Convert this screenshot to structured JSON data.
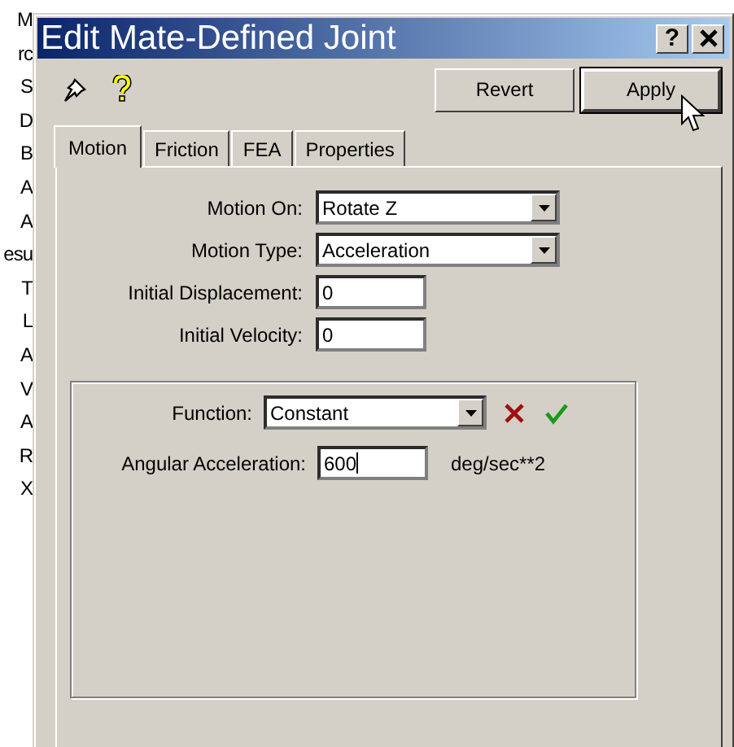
{
  "background_list": {
    "items": [
      "M",
      "rc",
      "S",
      "D",
      "B",
      "A",
      "A",
      "esu",
      "T",
      "L",
      "A",
      "V",
      "A",
      "R",
      "X"
    ]
  },
  "window": {
    "title": "Edit Mate-Defined Joint",
    "help_button": "?"
  },
  "toolbar": {
    "buttons": [
      {
        "label": "Revert",
        "focused": false
      },
      {
        "label": "Apply",
        "focused": true
      }
    ]
  },
  "tabs": [
    {
      "label": "Motion",
      "selected": true
    },
    {
      "label": "Friction",
      "selected": false
    },
    {
      "label": "FEA",
      "selected": false
    },
    {
      "label": "Properties",
      "selected": false
    }
  ],
  "fields": [
    {
      "kind": "dropdown",
      "label": "Motion On:",
      "value": "Rotate Z"
    },
    {
      "kind": "dropdown",
      "label": "Motion Type:",
      "value": "Acceleration"
    },
    {
      "kind": "text",
      "label": "Initial Displacement:",
      "value": "0"
    },
    {
      "kind": "text",
      "label": "Initial Velocity:",
      "value": "0"
    }
  ],
  "function_group": {
    "function": {
      "label": "Function:",
      "value": "Constant"
    },
    "parameter": {
      "label": "Angular Acceleration:",
      "value": "600",
      "unit": "deg/sec**2",
      "focused": true
    }
  }
}
